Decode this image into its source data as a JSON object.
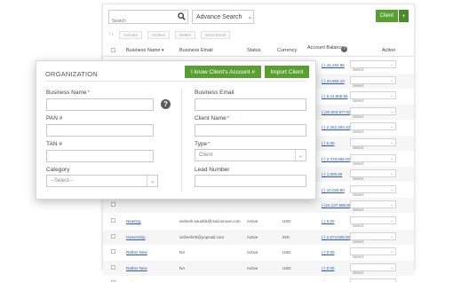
{
  "background": {
    "search": {
      "placeholder": "Search"
    },
    "advance_search": "Advance Search",
    "client_button": "Client",
    "toolbar": [
      "Activate",
      "Archive",
      "Delete",
      "Send Email"
    ],
    "columns": {
      "business_name": "Business Name",
      "business_email": "Business Email",
      "status": "Status",
      "currency": "Currency",
      "account_balance": "Account Balance",
      "action": "Action"
    },
    "rows": [
      {
        "name": "",
        "email": "",
        "status": "",
        "currency": "",
        "balance": "(-) 41,194.96",
        "action": "Select"
      },
      {
        "name": "",
        "email": "",
        "status": "",
        "currency": "",
        "balance": "(-) 24,684.10",
        "action": "Select"
      },
      {
        "name": "",
        "email": "",
        "status": "",
        "currency": "",
        "balance": "(-) 5,41,908.56",
        "action": "Select"
      },
      {
        "name": "",
        "email": "",
        "status": "",
        "currency": "",
        "balance": "(-)20,003,977.83",
        "action": "Select"
      },
      {
        "name": "",
        "email": "",
        "status": "",
        "currency": "",
        "balance": "(-) 2,252,493.10",
        "action": "Select"
      },
      {
        "name": "",
        "email": "",
        "status": "",
        "currency": "",
        "balance": "(-) 0.00",
        "action": "Select"
      },
      {
        "name": "",
        "email": "",
        "status": "",
        "currency": "",
        "balance": "(-) 2,378,598.00",
        "action": "Select"
      },
      {
        "name": "",
        "email": "",
        "status": "",
        "currency": "",
        "balance": "(-) 1,000.00",
        "action": "Select"
      },
      {
        "name": "",
        "email": "",
        "status": "",
        "currency": "",
        "balance": "(-) 10,029.90",
        "action": "Select"
      },
      {
        "name": "",
        "email": "",
        "status": "",
        "currency": "",
        "balance": "(-)24,137,595.80",
        "action": "Select"
      },
      {
        "name": "NewOrg",
        "email": "vishesh.kaushik@mail.vinove.com",
        "status": "Active",
        "currency": "USD",
        "balance": "(-) 0.00",
        "action": "Select"
      },
      {
        "name": "Ownership",
        "email": "vishesh00@yopmail.com",
        "status": "Active",
        "currency": "INR",
        "balance": "(-) 2,674,928.00",
        "action": "Select"
      },
      {
        "name": "Rather New",
        "email": "NA",
        "status": "Active",
        "currency": "USD",
        "balance": "(-) 0.00",
        "action": "Select"
      },
      {
        "name": "Rather New",
        "email": "NA",
        "status": "Active",
        "currency": "USD",
        "balance": "(-) 0.00",
        "action": "Select"
      },
      {
        "name": "Rather New",
        "email": "NA",
        "status": "Active",
        "currency": "USD",
        "balance": "(-) 0.00",
        "action": "Select"
      }
    ]
  },
  "modal": {
    "title": "ORGANIZATION",
    "know_account_button": "I know Client's Account #",
    "import_client_button": "Import Client",
    "left": {
      "business_name_label": "Business Name",
      "pan_label": "PAN #",
      "tan_label": "TAN #",
      "category_label": "Category",
      "category_value": "--Select--"
    },
    "right": {
      "business_email_label": "Business Email",
      "client_name_label": "Client Name",
      "type_label": "Type",
      "type_value": "Client",
      "lead_number_label": "Lead Number"
    },
    "required_mark": "*",
    "help_glyph": "?"
  },
  "colors": {
    "accent_green": "#5a9e32",
    "link_blue": "#2a5db0",
    "required_red": "#d9534f"
  },
  "icons": [
    "search-icon",
    "chevron-down-icon",
    "plus-icon",
    "help-icon",
    "checkbox-icon"
  ]
}
